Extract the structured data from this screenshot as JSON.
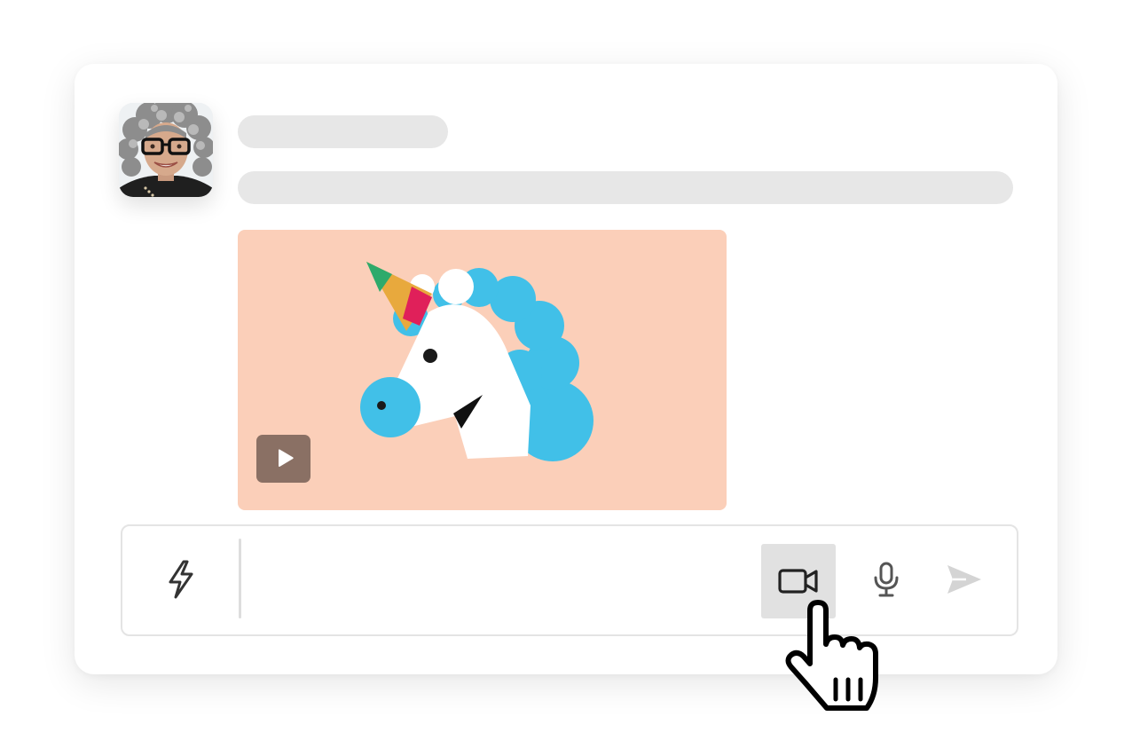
{
  "conversation": {
    "message": {
      "avatar_icon": "user-avatar-photo",
      "sender_name_placeholder": "",
      "message_text_placeholder": "",
      "attachment": {
        "type": "animated-gif",
        "subject": "unicorn-icon",
        "background_color": "#fbcfb9",
        "play_icon": "play-icon"
      }
    }
  },
  "composer": {
    "message_value": "",
    "message_placeholder": "",
    "shortcuts_icon": "lightning-bolt-icon",
    "record_video_icon": "video-camera-icon",
    "record_audio_icon": "microphone-icon",
    "send_icon": "send-icon",
    "send_enabled": false
  },
  "pointer": {
    "icon": "hand-pointer-icon",
    "hover_target": "record-video-button"
  },
  "colors": {
    "skeleton": "#e7e7e7",
    "hover_bg": "#e1e1e1",
    "icon": "#333333",
    "disabled_icon": "#d4d4d4",
    "play_bg": "#8a7064"
  }
}
